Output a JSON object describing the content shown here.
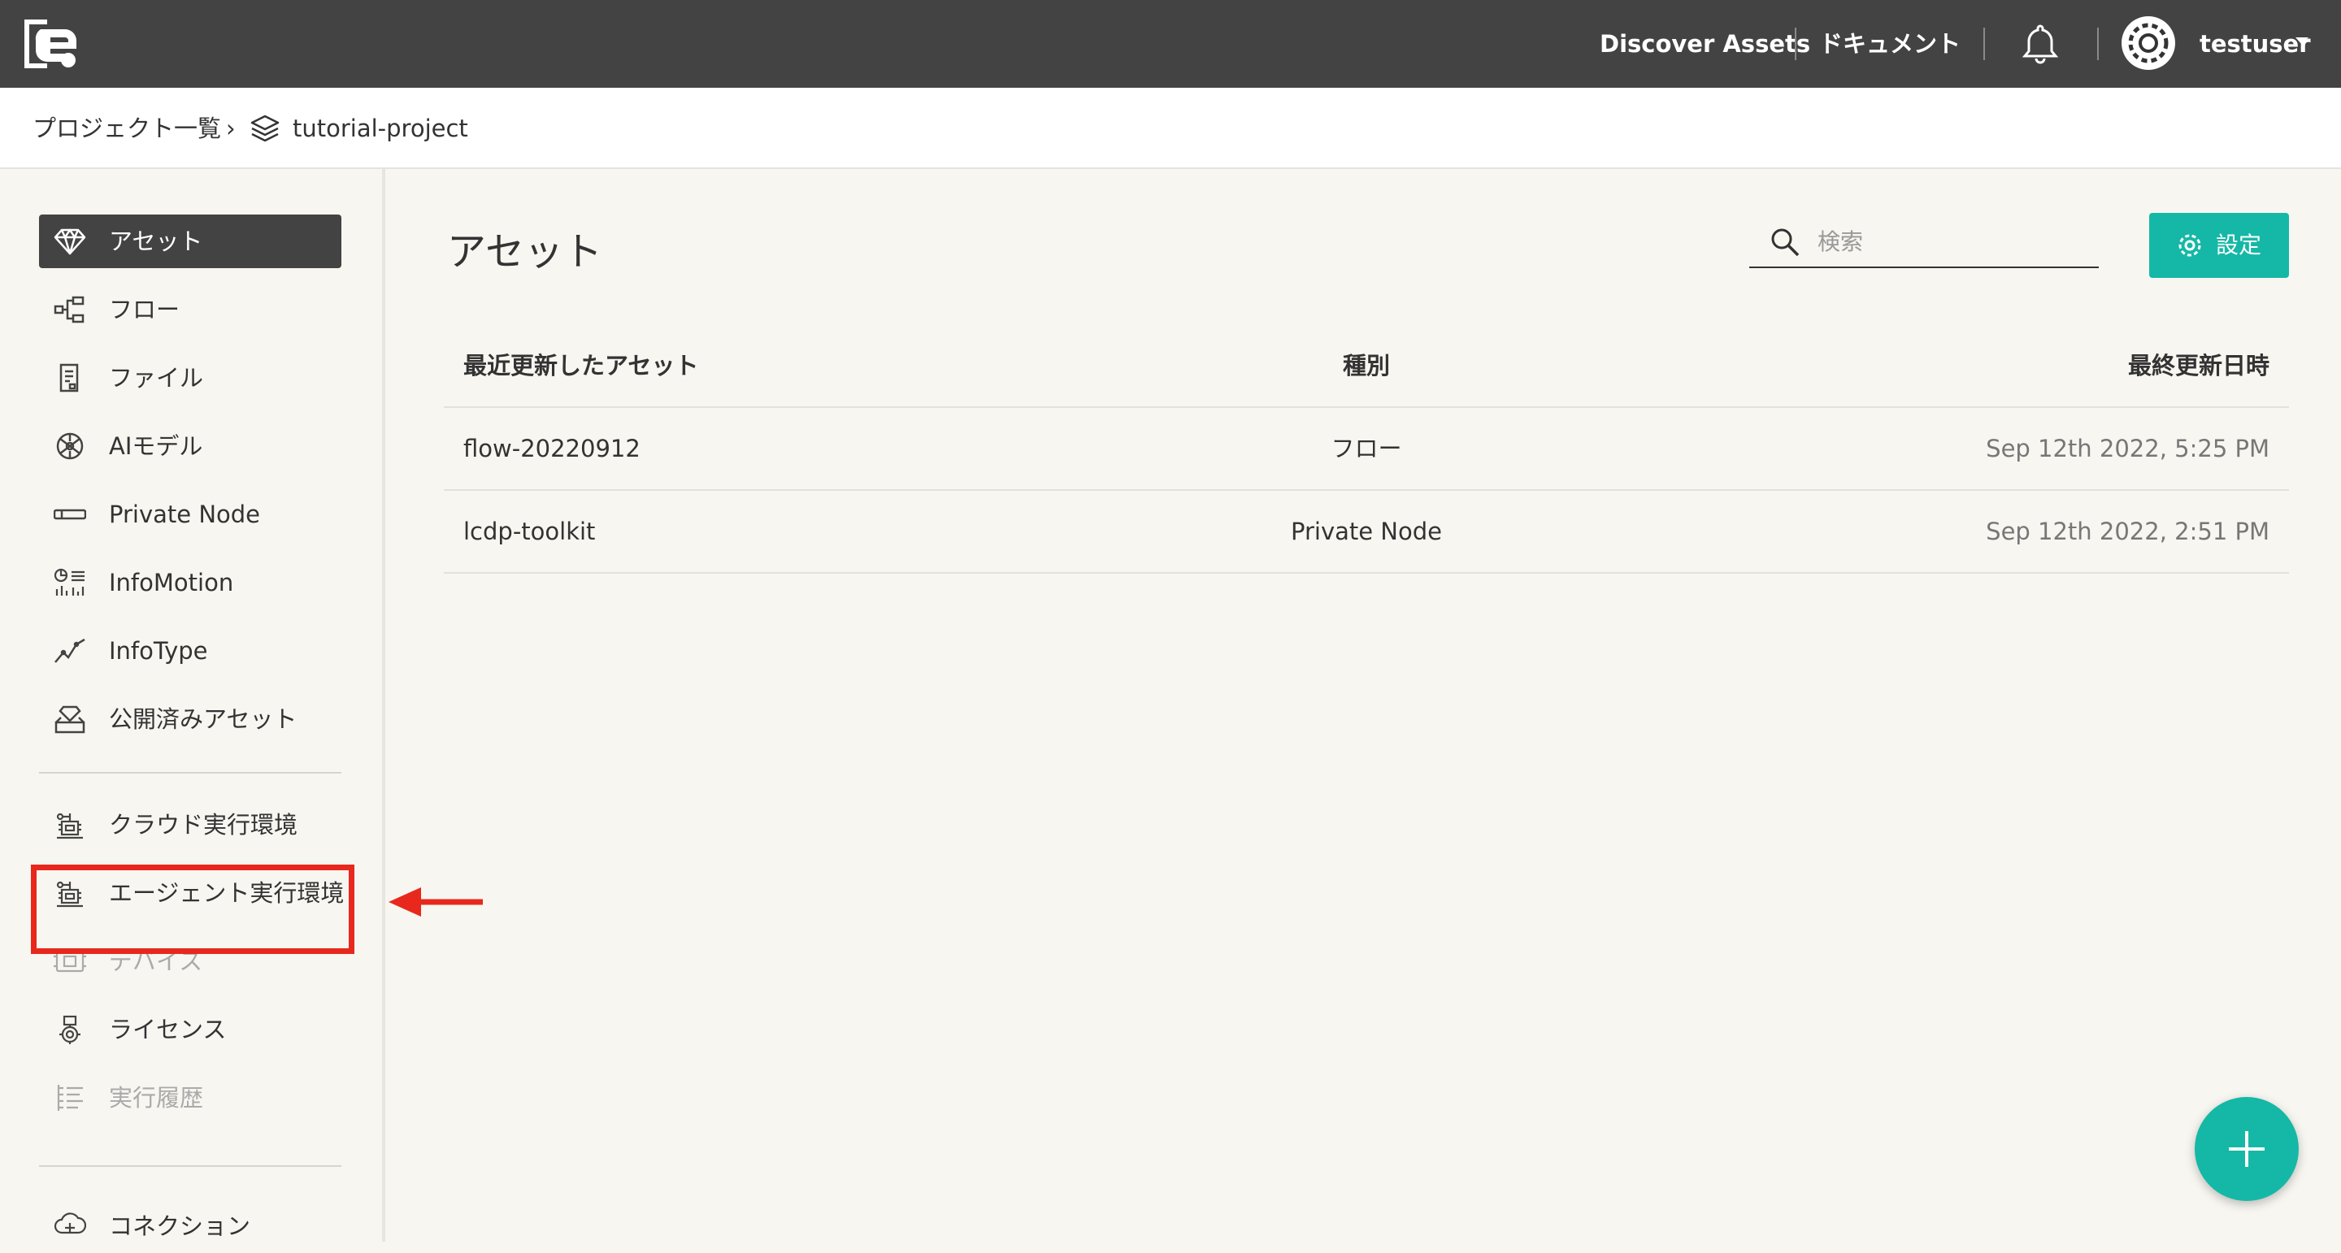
{
  "topbar": {
    "discover_label": "Discover Assets",
    "docs_label": "ドキュメント",
    "username": "testuser"
  },
  "breadcrumb": {
    "projects_label": "プロジェクト一覧",
    "separator": "›",
    "project_name": "tutorial-project"
  },
  "sidebar": {
    "items": [
      {
        "label": "アセット",
        "icon": "diamond-icon",
        "active": true
      },
      {
        "label": "フロー",
        "icon": "flow-icon"
      },
      {
        "label": "ファイル",
        "icon": "file-icon"
      },
      {
        "label": "AIモデル",
        "icon": "ai-model-icon"
      },
      {
        "label": "Private Node",
        "icon": "private-node-icon"
      },
      {
        "label": "InfoMotion",
        "icon": "infomotion-icon"
      },
      {
        "label": "InfoType",
        "icon": "infotype-icon"
      },
      {
        "label": "公開済みアセット",
        "icon": "published-assets-icon"
      },
      {
        "label": "クラウド実行環境",
        "icon": "cloud-runtime-icon"
      },
      {
        "label": "エージェント実行環境",
        "icon": "agent-runtime-icon",
        "highlighted": true
      },
      {
        "label": "デバイス",
        "icon": "device-icon",
        "disabled": true
      },
      {
        "label": "ライセンス",
        "icon": "license-icon"
      },
      {
        "label": "実行履歴",
        "icon": "history-icon",
        "disabled": true
      },
      {
        "label": "コネクション",
        "icon": "connection-icon"
      }
    ]
  },
  "main": {
    "title": "アセット",
    "search": {
      "placeholder": "検索",
      "value": ""
    },
    "settings_label": "設定",
    "table": {
      "headers": {
        "name": "最近更新したアセット",
        "type": "種別",
        "updated": "最終更新日時"
      },
      "rows": [
        {
          "name": "flow-20220912",
          "type": "フロー",
          "updated": "Sep 12th 2022, 5:25 PM"
        },
        {
          "name": "lcdp-toolkit",
          "type": "Private Node",
          "updated": "Sep 12th 2022, 2:51 PM"
        }
      ]
    }
  },
  "colors": {
    "topbar": "#434343",
    "accent": "#15b8a6",
    "highlight": "#e8281d",
    "background": "#f7f6f1"
  }
}
